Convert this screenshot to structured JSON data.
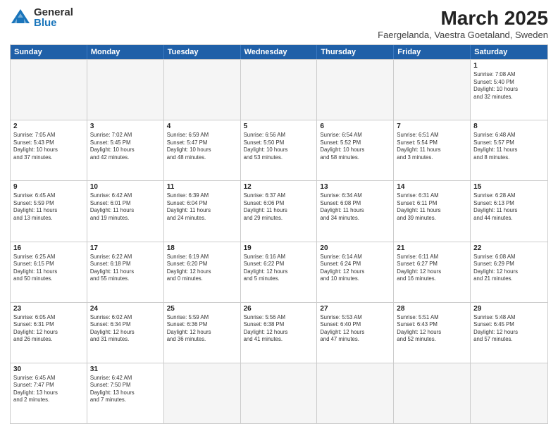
{
  "logo": {
    "general": "General",
    "blue": "Blue"
  },
  "title": "March 2025",
  "subtitle": "Faergelanda, Vaestra Goetaland, Sweden",
  "header_days": [
    "Sunday",
    "Monday",
    "Tuesday",
    "Wednesday",
    "Thursday",
    "Friday",
    "Saturday"
  ],
  "weeks": [
    [
      {
        "day": "",
        "info": ""
      },
      {
        "day": "",
        "info": ""
      },
      {
        "day": "",
        "info": ""
      },
      {
        "day": "",
        "info": ""
      },
      {
        "day": "",
        "info": ""
      },
      {
        "day": "",
        "info": ""
      },
      {
        "day": "1",
        "info": "Sunrise: 7:08 AM\nSunset: 5:40 PM\nDaylight: 10 hours\nand 32 minutes."
      }
    ],
    [
      {
        "day": "2",
        "info": "Sunrise: 7:05 AM\nSunset: 5:43 PM\nDaylight: 10 hours\nand 37 minutes."
      },
      {
        "day": "3",
        "info": "Sunrise: 7:02 AM\nSunset: 5:45 PM\nDaylight: 10 hours\nand 42 minutes."
      },
      {
        "day": "4",
        "info": "Sunrise: 6:59 AM\nSunset: 5:47 PM\nDaylight: 10 hours\nand 48 minutes."
      },
      {
        "day": "5",
        "info": "Sunrise: 6:56 AM\nSunset: 5:50 PM\nDaylight: 10 hours\nand 53 minutes."
      },
      {
        "day": "6",
        "info": "Sunrise: 6:54 AM\nSunset: 5:52 PM\nDaylight: 10 hours\nand 58 minutes."
      },
      {
        "day": "7",
        "info": "Sunrise: 6:51 AM\nSunset: 5:54 PM\nDaylight: 11 hours\nand 3 minutes."
      },
      {
        "day": "8",
        "info": "Sunrise: 6:48 AM\nSunset: 5:57 PM\nDaylight: 11 hours\nand 8 minutes."
      }
    ],
    [
      {
        "day": "9",
        "info": "Sunrise: 6:45 AM\nSunset: 5:59 PM\nDaylight: 11 hours\nand 13 minutes."
      },
      {
        "day": "10",
        "info": "Sunrise: 6:42 AM\nSunset: 6:01 PM\nDaylight: 11 hours\nand 19 minutes."
      },
      {
        "day": "11",
        "info": "Sunrise: 6:39 AM\nSunset: 6:04 PM\nDaylight: 11 hours\nand 24 minutes."
      },
      {
        "day": "12",
        "info": "Sunrise: 6:37 AM\nSunset: 6:06 PM\nDaylight: 11 hours\nand 29 minutes."
      },
      {
        "day": "13",
        "info": "Sunrise: 6:34 AM\nSunset: 6:08 PM\nDaylight: 11 hours\nand 34 minutes."
      },
      {
        "day": "14",
        "info": "Sunrise: 6:31 AM\nSunset: 6:11 PM\nDaylight: 11 hours\nand 39 minutes."
      },
      {
        "day": "15",
        "info": "Sunrise: 6:28 AM\nSunset: 6:13 PM\nDaylight: 11 hours\nand 44 minutes."
      }
    ],
    [
      {
        "day": "16",
        "info": "Sunrise: 6:25 AM\nSunset: 6:15 PM\nDaylight: 11 hours\nand 50 minutes."
      },
      {
        "day": "17",
        "info": "Sunrise: 6:22 AM\nSunset: 6:18 PM\nDaylight: 11 hours\nand 55 minutes."
      },
      {
        "day": "18",
        "info": "Sunrise: 6:19 AM\nSunset: 6:20 PM\nDaylight: 12 hours\nand 0 minutes."
      },
      {
        "day": "19",
        "info": "Sunrise: 6:16 AM\nSunset: 6:22 PM\nDaylight: 12 hours\nand 5 minutes."
      },
      {
        "day": "20",
        "info": "Sunrise: 6:14 AM\nSunset: 6:24 PM\nDaylight: 12 hours\nand 10 minutes."
      },
      {
        "day": "21",
        "info": "Sunrise: 6:11 AM\nSunset: 6:27 PM\nDaylight: 12 hours\nand 16 minutes."
      },
      {
        "day": "22",
        "info": "Sunrise: 6:08 AM\nSunset: 6:29 PM\nDaylight: 12 hours\nand 21 minutes."
      }
    ],
    [
      {
        "day": "23",
        "info": "Sunrise: 6:05 AM\nSunset: 6:31 PM\nDaylight: 12 hours\nand 26 minutes."
      },
      {
        "day": "24",
        "info": "Sunrise: 6:02 AM\nSunset: 6:34 PM\nDaylight: 12 hours\nand 31 minutes."
      },
      {
        "day": "25",
        "info": "Sunrise: 5:59 AM\nSunset: 6:36 PM\nDaylight: 12 hours\nand 36 minutes."
      },
      {
        "day": "26",
        "info": "Sunrise: 5:56 AM\nSunset: 6:38 PM\nDaylight: 12 hours\nand 41 minutes."
      },
      {
        "day": "27",
        "info": "Sunrise: 5:53 AM\nSunset: 6:40 PM\nDaylight: 12 hours\nand 47 minutes."
      },
      {
        "day": "28",
        "info": "Sunrise: 5:51 AM\nSunset: 6:43 PM\nDaylight: 12 hours\nand 52 minutes."
      },
      {
        "day": "29",
        "info": "Sunrise: 5:48 AM\nSunset: 6:45 PM\nDaylight: 12 hours\nand 57 minutes."
      }
    ],
    [
      {
        "day": "30",
        "info": "Sunrise: 6:45 AM\nSunset: 7:47 PM\nDaylight: 13 hours\nand 2 minutes."
      },
      {
        "day": "31",
        "info": "Sunrise: 6:42 AM\nSunset: 7:50 PM\nDaylight: 13 hours\nand 7 minutes."
      },
      {
        "day": "",
        "info": ""
      },
      {
        "day": "",
        "info": ""
      },
      {
        "day": "",
        "info": ""
      },
      {
        "day": "",
        "info": ""
      },
      {
        "day": "",
        "info": ""
      }
    ]
  ]
}
